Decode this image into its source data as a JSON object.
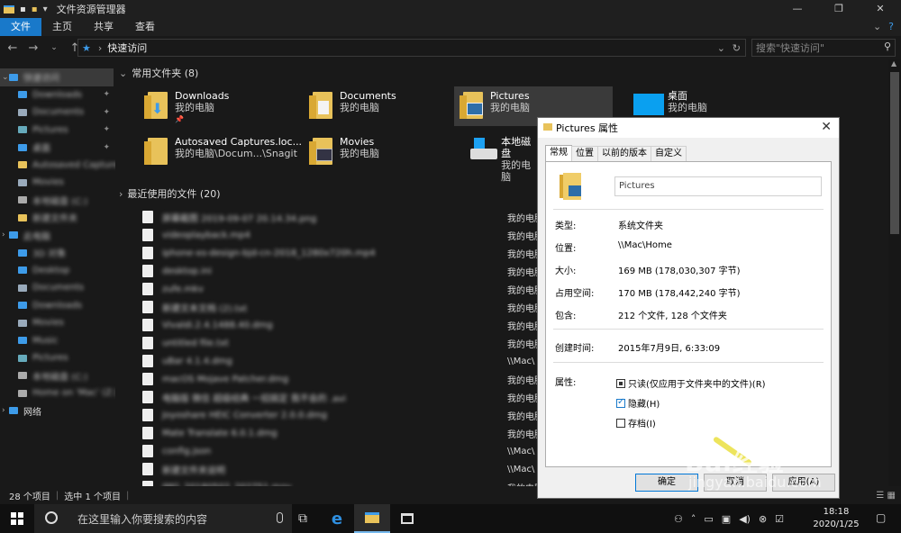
{
  "window": {
    "title": "文件资源管理器"
  },
  "ribbon": {
    "tabs": [
      "文件",
      "主页",
      "共享",
      "查看"
    ]
  },
  "address": {
    "path": "快速访问",
    "search_placeholder": "搜索\"快速访问\""
  },
  "nav": {
    "items": [
      {
        "label": "快速访问",
        "color": "#3d9be9"
      },
      {
        "label": "Downloads",
        "color": "#3d9be9"
      },
      {
        "label": "Documents",
        "color": "#9ab"
      },
      {
        "label": "Pictures",
        "color": "#6ab"
      },
      {
        "label": "桌面",
        "color": "#3d9be9"
      },
      {
        "label": "Autosaved Captures",
        "color": "#e8c25a"
      },
      {
        "label": "Movies",
        "color": "#9ab"
      },
      {
        "label": "本地磁盘 (C:)",
        "color": "#aaa"
      },
      {
        "label": "新建文件夹",
        "color": "#e8c25a"
      },
      {
        "label": "此电脑",
        "color": "#3d9be9"
      },
      {
        "label": "3D 对象",
        "color": "#3d9be9"
      },
      {
        "label": "Desktop",
        "color": "#3d9be9"
      },
      {
        "label": "Documents",
        "color": "#9ab"
      },
      {
        "label": "Downloads",
        "color": "#3d9be9"
      },
      {
        "label": "Movies",
        "color": "#9ab"
      },
      {
        "label": "Music",
        "color": "#3d9be9"
      },
      {
        "label": "Pictures",
        "color": "#6ab"
      },
      {
        "label": "本地磁盘 (C:)",
        "color": "#aaa"
      },
      {
        "label": "Home on 'Mac' (Z:)",
        "color": "#aaa"
      },
      {
        "label": "网络",
        "color": "#3d9be9"
      }
    ]
  },
  "content": {
    "frequent_header": "常用文件夹 (8)",
    "recent_header": "最近使用的文件 (20)",
    "frequent": [
      {
        "name": "Downloads",
        "sub": "我的电脑"
      },
      {
        "name": "Documents",
        "sub": "我的电脑"
      },
      {
        "name": "Pictures",
        "sub": "我的电脑"
      },
      {
        "name": "桌面",
        "sub": "我的电脑"
      },
      {
        "name": "Autosaved Captures.loc...",
        "sub": "我的电脑\\Docum...\\Snagit"
      },
      {
        "name": "Movies",
        "sub": "我的电脑"
      },
      {
        "name": "本地磁盘",
        "sub": "我的电脑"
      }
    ],
    "recent": [
      {
        "name": "屏幕截图 2019-09-07 20.14.34.png",
        "loc": "我的电脑"
      },
      {
        "name": "videoplayback.mp4",
        "loc": "我的电脑"
      },
      {
        "name": "iphone-xs-design-bjd-cn-2018_1280x720h.mp4",
        "loc": "我的电脑"
      },
      {
        "name": "desktop.ini",
        "loc": "我的电脑"
      },
      {
        "name": "zufe.mkv",
        "loc": "我的电脑"
      },
      {
        "name": "新建文本文档 (2).txt",
        "loc": "我的电脑"
      },
      {
        "name": "Vivaldi.2.4.1488.40.dmg",
        "loc": "我的电脑"
      },
      {
        "name": "untitled file.txt",
        "loc": "我的电脑"
      },
      {
        "name": "uBar 4.1.4.dmg",
        "loc": "\\\\Mac\\"
      },
      {
        "name": "macOS Mojave Patcher.dmg",
        "loc": "我的电脑"
      },
      {
        "name": "电脑版 微信 超级经典 一招搞定 我不会的 .avi",
        "loc": "我的电脑"
      },
      {
        "name": "Joyoshare HEIC Converter 2.0.0.dmg",
        "loc": "我的电脑"
      },
      {
        "name": "Mate Translate 6.0.1.dmg",
        "loc": "我的电脑"
      },
      {
        "name": "config.json",
        "loc": "\\\\Mac\\"
      },
      {
        "name": "新建文件夹说明",
        "loc": "\\\\Mac\\"
      },
      {
        "name": "IMG_20180502_202751.mov",
        "loc": "我的电脑"
      }
    ]
  },
  "status": {
    "count": "28 个项目",
    "selected": "选中 1 个项目"
  },
  "dialog": {
    "title": "Pictures 属性",
    "tabs": [
      "常规",
      "位置",
      "以前的版本",
      "自定义"
    ],
    "name": "Pictures",
    "props": [
      {
        "k": "类型:",
        "v": "系统文件夹"
      },
      {
        "k": "位置:",
        "v": "\\\\Mac\\Home"
      },
      {
        "k": "大小:",
        "v": "169 MB (178,030,307 字节)"
      },
      {
        "k": "占用空间:",
        "v": "170 MB (178,442,240 字节)"
      },
      {
        "k": "包含:",
        "v": "212 个文件, 128 个文件夹"
      }
    ],
    "created_label": "创建时间:",
    "created_value": "2015年7月9日, 6:33:09",
    "attr_label": "属性:",
    "attr_readonly": "只读(仅应用于文件夹中的文件)(R)",
    "attr_hidden": "隐藏(H)",
    "attr_archive": "存档(I)",
    "ok": "确定",
    "cancel": "取消",
    "apply": "应用(A)"
  },
  "taskbar": {
    "search_placeholder": "在这里输入你要搜索的内容",
    "time": "18:18",
    "date": "2020/1/25"
  },
  "watermark": {
    "brand": "Bai经验",
    "site": "jingyan.baidu.com"
  }
}
